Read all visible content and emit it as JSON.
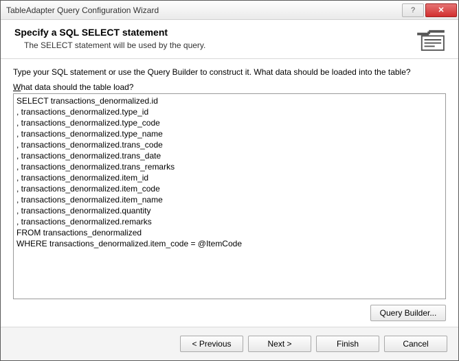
{
  "window": {
    "title": "TableAdapter Query Configuration Wizard"
  },
  "header": {
    "title": "Specify a SQL SELECT statement",
    "subtitle": "The SELECT statement will be used by the query."
  },
  "body": {
    "instruction": "Type your SQL statement or use the Query Builder to construct it. What data should be loaded into the table?",
    "label_prefix": "W",
    "label_rest": "hat data should the table load?",
    "sql": "SELECT transactions_denormalized.id\n, transactions_denormalized.type_id\n, transactions_denormalized.type_code\n, transactions_denormalized.type_name\n, transactions_denormalized.trans_code\n, transactions_denormalized.trans_date\n, transactions_denormalized.trans_remarks\n, transactions_denormalized.item_id\n, transactions_denormalized.item_code\n, transactions_denormalized.item_name\n, transactions_denormalized.quantity\n, transactions_denormalized.remarks\nFROM transactions_denormalized\nWHERE transactions_denormalized.item_code = @ItemCode",
    "query_builder": "Query Builder..."
  },
  "footer": {
    "previous": "< Previous",
    "next": "Next >",
    "finish": "Finish",
    "cancel": "Cancel"
  }
}
